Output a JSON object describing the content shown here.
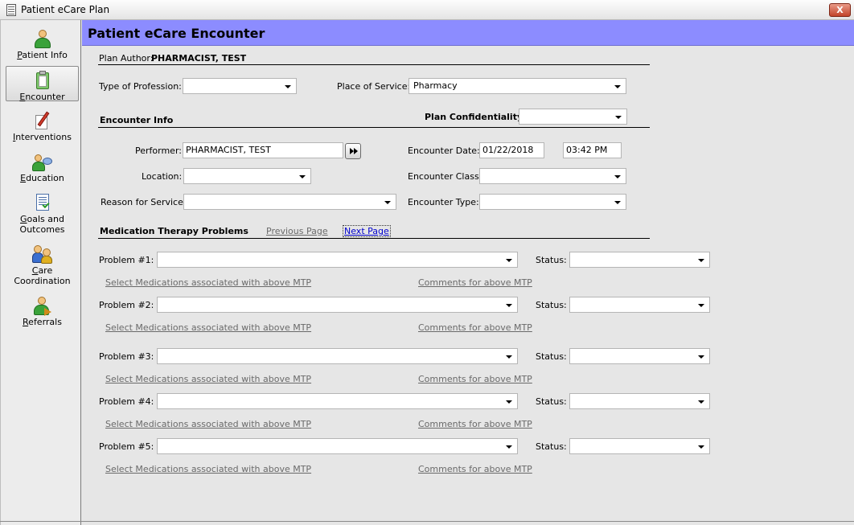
{
  "window": {
    "title": "Patient eCare Plan",
    "close_label": "X"
  },
  "sidebar": {
    "items": [
      {
        "key": "P",
        "rest": "atient Info",
        "icon": "patient-icon",
        "selected": false
      },
      {
        "key": "E",
        "rest": "ncounter",
        "icon": "clipboard-icon",
        "selected": true
      },
      {
        "key": "I",
        "rest": "nterventions",
        "icon": "checklist-pen-icon",
        "selected": false
      },
      {
        "key": "E",
        "rest": "ducation",
        "icon": "education-icon",
        "selected": false
      },
      {
        "key": "G",
        "rest": "oals and",
        "line2": "Outcomes",
        "icon": "goals-icon",
        "selected": false
      },
      {
        "key": "C",
        "rest": "are",
        "line2": "Coordination",
        "icon": "care-coordination-icon",
        "selected": false
      },
      {
        "key": "R",
        "rest": "eferrals",
        "icon": "referrals-icon",
        "selected": false
      }
    ]
  },
  "header": {
    "title": "Patient eCare Encounter"
  },
  "plan_author": {
    "label": "Plan Author:",
    "value": "PHARMACIST, TEST"
  },
  "profession": {
    "label": "Type of Profession:",
    "value": ""
  },
  "place_of_service": {
    "label": "Place of Service:",
    "value": "Pharmacy"
  },
  "encounter_info": {
    "section_title": "Encounter Info",
    "confidentiality_label": "Plan Confidentiality",
    "confidentiality_value": "",
    "performer_label": "Performer:",
    "performer_value": "PHARMACIST, TEST",
    "date_label": "Encounter Date:",
    "date_value": "01/22/2018",
    "time_value": "03:42 PM",
    "location_label": "Location:",
    "location_value": "",
    "class_label": "Encounter Class:",
    "class_value": "",
    "reason_label": "Reason for Service:",
    "reason_value": "",
    "type_label": "Encounter Type:",
    "type_value": ""
  },
  "mtp": {
    "section_title": "Medication Therapy Problems",
    "previous_page": "Previous Page",
    "next_page": "Next Page",
    "status_label": "Status:",
    "select_meds_link": "Select Medications associated with above MTP",
    "comments_link": "Comments for above MTP",
    "problems": [
      {
        "label": "Problem #1:",
        "value": "",
        "status": ""
      },
      {
        "label": "Problem #2:",
        "value": "",
        "status": ""
      },
      {
        "label": "Problem #3:",
        "value": "",
        "status": ""
      },
      {
        "label": "Problem #4:",
        "value": "",
        "status": ""
      },
      {
        "label": "Problem #5:",
        "value": "",
        "status": ""
      }
    ]
  }
}
